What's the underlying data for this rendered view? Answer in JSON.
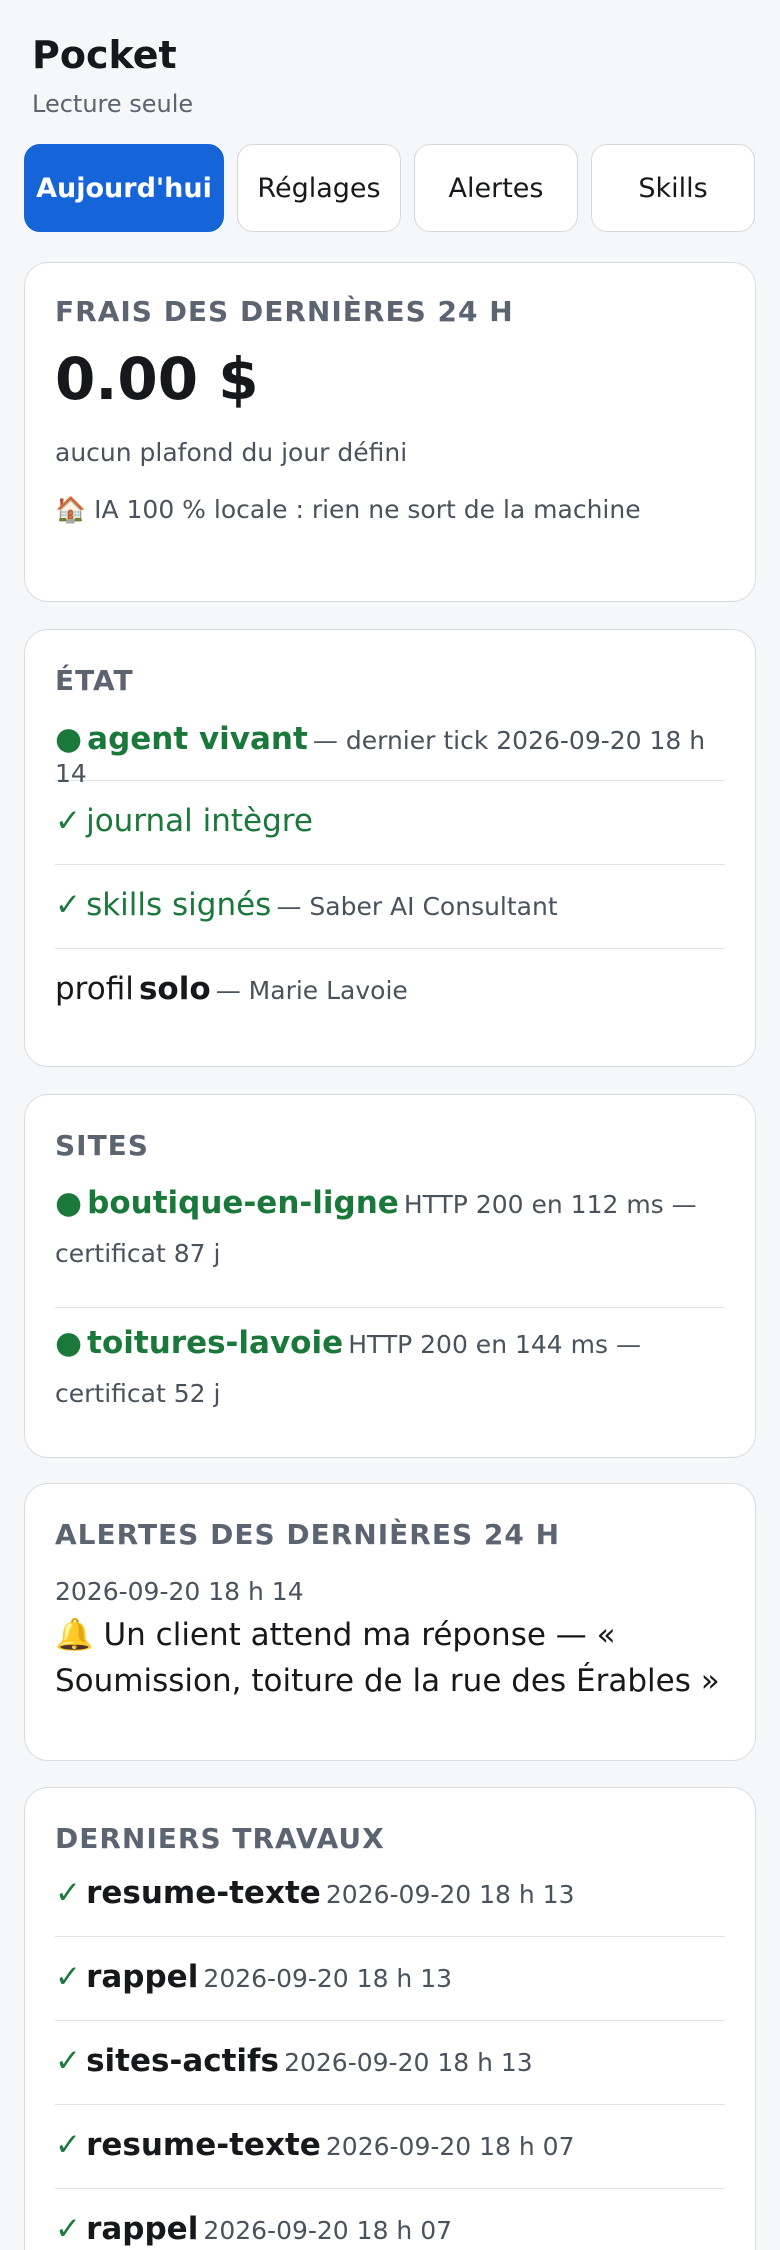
{
  "app": {
    "title": "Pocket",
    "subtitle": "Lecture seule"
  },
  "tabs": [
    {
      "label": "Aujourd'hui",
      "active": true
    },
    {
      "label": "Réglages",
      "active": false
    },
    {
      "label": "Alertes",
      "active": false
    },
    {
      "label": "Skills",
      "active": false
    }
  ],
  "fees": {
    "title": "FRAIS DES DERNIÈRES 24 H",
    "amount": "0.00 $",
    "note": "aucun plafond du jour défini",
    "local_icon": "🏠",
    "local_text": "IA 100 % locale : rien ne sort de la machine"
  },
  "status": {
    "title": "ÉTAT",
    "agent_bullet": "●",
    "agent_label": "agent vivant",
    "agent_detail": "— dernier tick 2026-09-20 18 h 14",
    "journal_check": "✓",
    "journal_label": "journal intègre",
    "skills_check": "✓",
    "skills_label": "skills signés",
    "skills_detail": "— Saber AI Consultant",
    "profile_prefix": "profil",
    "profile_value": "solo",
    "profile_detail": "— Marie Lavoie"
  },
  "sites": {
    "title": "SITES",
    "items": [
      {
        "bullet": "●",
        "name": "boutique-en-ligne",
        "detail": "HTTP 200 en 112 ms — certificat 87 j"
      },
      {
        "bullet": "●",
        "name": "toitures-lavoie",
        "detail": "HTTP 200 en 144 ms — certificat 52 j"
      }
    ]
  },
  "alerts": {
    "title": "ALERTES DES DERNIÈRES 24 H",
    "items": [
      {
        "time": "2026-09-20 18 h 14",
        "icon": "🔔",
        "text": "Un client attend ma réponse — « Soumission, toiture de la rue des Érables »"
      }
    ]
  },
  "jobs": {
    "title": "DERNIERS TRAVAUX",
    "items": [
      {
        "check": "✓",
        "name": "resume-texte",
        "time": "2026-09-20 18 h 13"
      },
      {
        "check": "✓",
        "name": "rappel",
        "time": "2026-09-20 18 h 13"
      },
      {
        "check": "✓",
        "name": "sites-actifs",
        "time": "2026-09-20 18 h 13"
      },
      {
        "check": "✓",
        "name": "resume-texte",
        "time": "2026-09-20 18 h 07"
      },
      {
        "check": "✓",
        "name": "rappel",
        "time": "2026-09-20 18 h 07"
      }
    ]
  },
  "colors": {
    "accent": "#1565d8",
    "ok_green": "#19783a",
    "muted_text": "#5b6470"
  }
}
